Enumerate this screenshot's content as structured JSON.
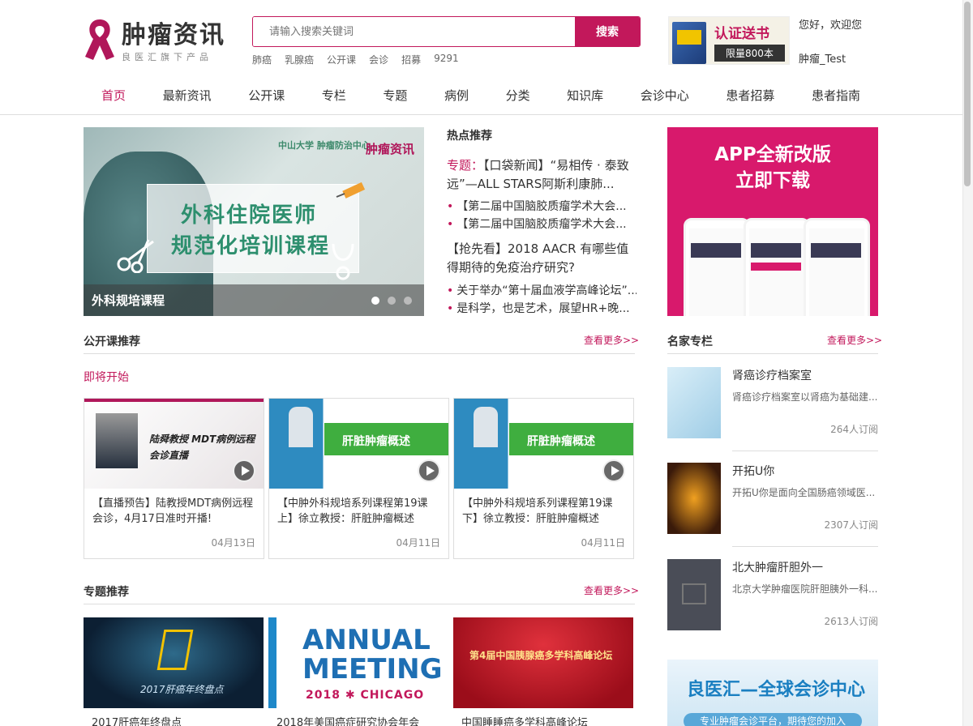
{
  "header": {
    "logo_text": "肿瘤资讯",
    "logo_sub": "良医汇旗下产品",
    "search_placeholder": "请输入搜索关键词",
    "search_button": "搜索",
    "hot_tags": [
      "肺癌",
      "乳腺癌",
      "公开课",
      "会诊",
      "招募",
      "9291"
    ],
    "promo_title": "认证送书",
    "promo_sub": "限量800本",
    "greeting": "您好，欢迎您",
    "username": "肿瘤_Test"
  },
  "nav": [
    "首页",
    "最新资讯",
    "公开课",
    "专栏",
    "专题",
    "病例",
    "分类",
    "知识库",
    "会诊中心",
    "患者招募",
    "患者指南"
  ],
  "banner": {
    "line1": "外科住院医师",
    "line2": "规范化培训课程",
    "logo_univ": "中山大学 肿瘤防治中心",
    "logo_brand": "肿瘤资讯",
    "caption": "外科规培课程"
  },
  "hot": {
    "title": "热点推荐",
    "main_prefix": "专题：",
    "main_text": "【口袋新闻】“易相传 · 泰致远”—ALL STARS阿斯利康肺...",
    "items1": [
      "【第二届中国脑胶质瘤学术大会...",
      "【第二届中国脑胶质瘤学术大会..."
    ],
    "headline2": "【抢先看】2018 AACR 有哪些值得期待的免疫治疗研究?",
    "items2": [
      "关于举办“第十届血液学高峰论坛”...",
      "是科学，也是艺术，展望HR+晚..."
    ]
  },
  "app_banner": {
    "line1": "APP全新改版",
    "line2": "立即下载"
  },
  "courses": {
    "title": "公开课推荐",
    "more": "查看更多>>",
    "soon": "即将开始",
    "cards": [
      {
        "title": "【直播预告】陆教授MDT病例远程会诊，4月17日准时开播!",
        "date": "04月13日",
        "img_text": "陆舜教授 MDT病例远程会诊直播"
      },
      {
        "title": "【中肿外科规培系列课程第19课上】徐立教授：肝脏肿瘤概述",
        "date": "04月11日",
        "img_text": "肝脏肿瘤概述"
      },
      {
        "title": "【中肿外科规培系列课程第19课下】徐立教授：肝脏肿瘤概述",
        "date": "04月11日",
        "img_text": "肝脏肿瘤概述"
      }
    ]
  },
  "topics": {
    "title": "专题推荐",
    "more": "查看更多>>",
    "items": [
      {
        "caption": "2017肝癌年终盘点",
        "img_text": "2017肝癌年终盘点"
      },
      {
        "caption": "2018年美国癌症研究协会年会",
        "img_text1": "ANNUAL",
        "img_text2": "MEETING",
        "img_text3": "2018 ✱ CHICAGO"
      },
      {
        "caption": "中国睡睡癌多学科高峰论坛",
        "img_text": "第4届中国胰腺癌多学科高峰论坛"
      }
    ]
  },
  "columns": {
    "title": "名家专栏",
    "more": "查看更多>>",
    "items": [
      {
        "name": "肾癌诊疗档案室",
        "desc": "肾癌诊疗档案室以肾癌为基础建...",
        "subs": "264人订阅"
      },
      {
        "name": "开拓U你",
        "desc": "开拓U你是面向全国肠癌领域医...",
        "subs": "2307人订阅"
      },
      {
        "name": "北大肿瘤肝胆外一",
        "desc": "北京大学肿瘤医院肝胆胰外一科...",
        "subs": "2613人订阅"
      }
    ]
  },
  "consult_banner": {
    "title": "良医汇—全球会诊中心",
    "sub": "专业肿瘤会诊平台，期待您的加入"
  },
  "colors": {
    "accent": "#c2185b"
  }
}
